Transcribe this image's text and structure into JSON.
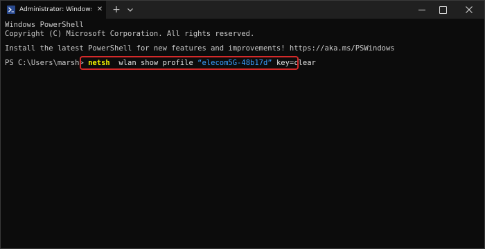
{
  "titlebar": {
    "tab_title": "Administrator: Windows PowerS",
    "tab_close_glyph": "✕",
    "new_tab_glyph": "+",
    "dropdown_glyph": "⌄",
    "close_glyph": "✕"
  },
  "terminal": {
    "lines": [
      "Windows PowerShell",
      "Copyright (C) Microsoft Corporation. All rights reserved.",
      "Install the latest PowerShell for new features and improvements! https://aka.ms/PSWindows"
    ],
    "prompt": "PS C:\\Users\\marsh> ",
    "command": {
      "keyword": "netsh",
      "args": "  wlan show profile ",
      "string_arg": "“elecom5G-48b17d”",
      "tail": " key=clear"
    }
  },
  "colors": {
    "terminal_bg": "#0c0c0c",
    "text": "#cccccc",
    "keyword": "#f2f200",
    "string": "#3aa0ff",
    "highlight_border": "#d42a2a"
  },
  "icons": {
    "tab_icon": "powershell-icon",
    "minimize": "minimize-icon",
    "maximize": "maximize-icon",
    "close": "close-icon"
  }
}
